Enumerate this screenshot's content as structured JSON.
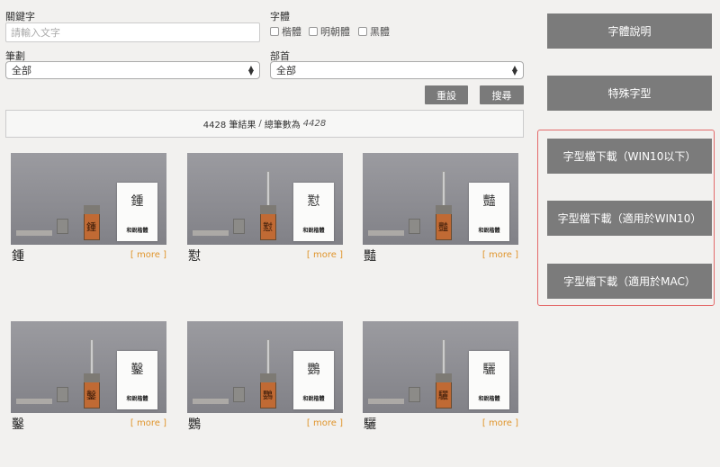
{
  "search": {
    "keyword_label": "關鍵字",
    "keyword_placeholder": "請輸入文字",
    "font_label": "字體",
    "font_options": [
      "楷體",
      "明朝體",
      "黑體"
    ],
    "strokes_label": "筆劃",
    "strokes_value": "全部",
    "radical_label": "部首",
    "radical_value": "全部",
    "reset_label": "重設",
    "search_label": "搜尋"
  },
  "results": {
    "count_text": "4428 筆結果",
    "separator": "/",
    "total_label": "總筆數為",
    "total_value": "4428"
  },
  "cards": [
    {
      "char": "鍾",
      "photo_char": "鍾",
      "label": "和銳楷體",
      "more": "[ more ]"
    },
    {
      "char": "懟",
      "photo_char": "懟",
      "label": "和銳楷體",
      "more": "[ more ]"
    },
    {
      "char": "豔",
      "photo_char": "豔",
      "label": "和銳楷體",
      "more": "[ more ]"
    },
    {
      "char": "鑿",
      "photo_char": "鑿",
      "label": "和銳楷體",
      "more": "[ more ]"
    },
    {
      "char": "鸚",
      "photo_char": "鸚",
      "label": "和銳楷體",
      "more": "[ more ]"
    },
    {
      "char": "驪",
      "photo_char": "驪",
      "label": "和銳楷體",
      "more": "[ more ]"
    }
  ],
  "sidebar": {
    "font_info": "字體說明",
    "special_chars": "特殊字型",
    "download_win10_below": "字型檔下載（WIN10以下）",
    "download_win10": "字型檔下載（適用於WIN10）",
    "download_mac": "字型檔下載（適用於MAC）"
  }
}
